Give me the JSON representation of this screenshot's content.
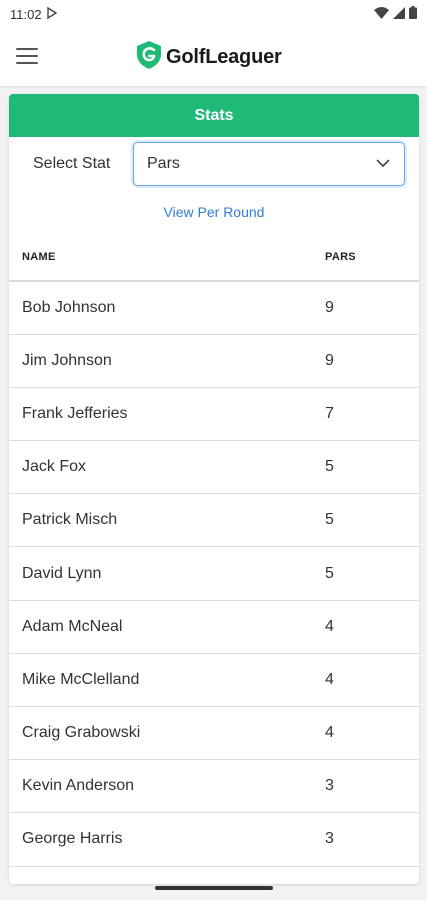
{
  "status_bar": {
    "time": "11:02"
  },
  "app": {
    "name": "GolfLeaguer",
    "brand_color": "#1fba78"
  },
  "stats": {
    "header": "Stats",
    "select_label": "Select Stat",
    "selected_stat": "Pars",
    "view_link": "View Per Round",
    "columns": {
      "name": "NAME",
      "value": "PARS"
    },
    "rows": [
      {
        "name": "Bob Johnson",
        "value": "9"
      },
      {
        "name": "Jim Johnson",
        "value": "9"
      },
      {
        "name": "Frank Jefferies",
        "value": "7"
      },
      {
        "name": "Jack Fox",
        "value": "5"
      },
      {
        "name": "Patrick Misch",
        "value": "5"
      },
      {
        "name": "David Lynn",
        "value": "5"
      },
      {
        "name": "Adam McNeal",
        "value": "4"
      },
      {
        "name": "Mike McClelland",
        "value": "4"
      },
      {
        "name": "Craig Grabowski",
        "value": "4"
      },
      {
        "name": "Kevin Anderson",
        "value": "3"
      },
      {
        "name": "George Harris",
        "value": "3"
      }
    ]
  }
}
